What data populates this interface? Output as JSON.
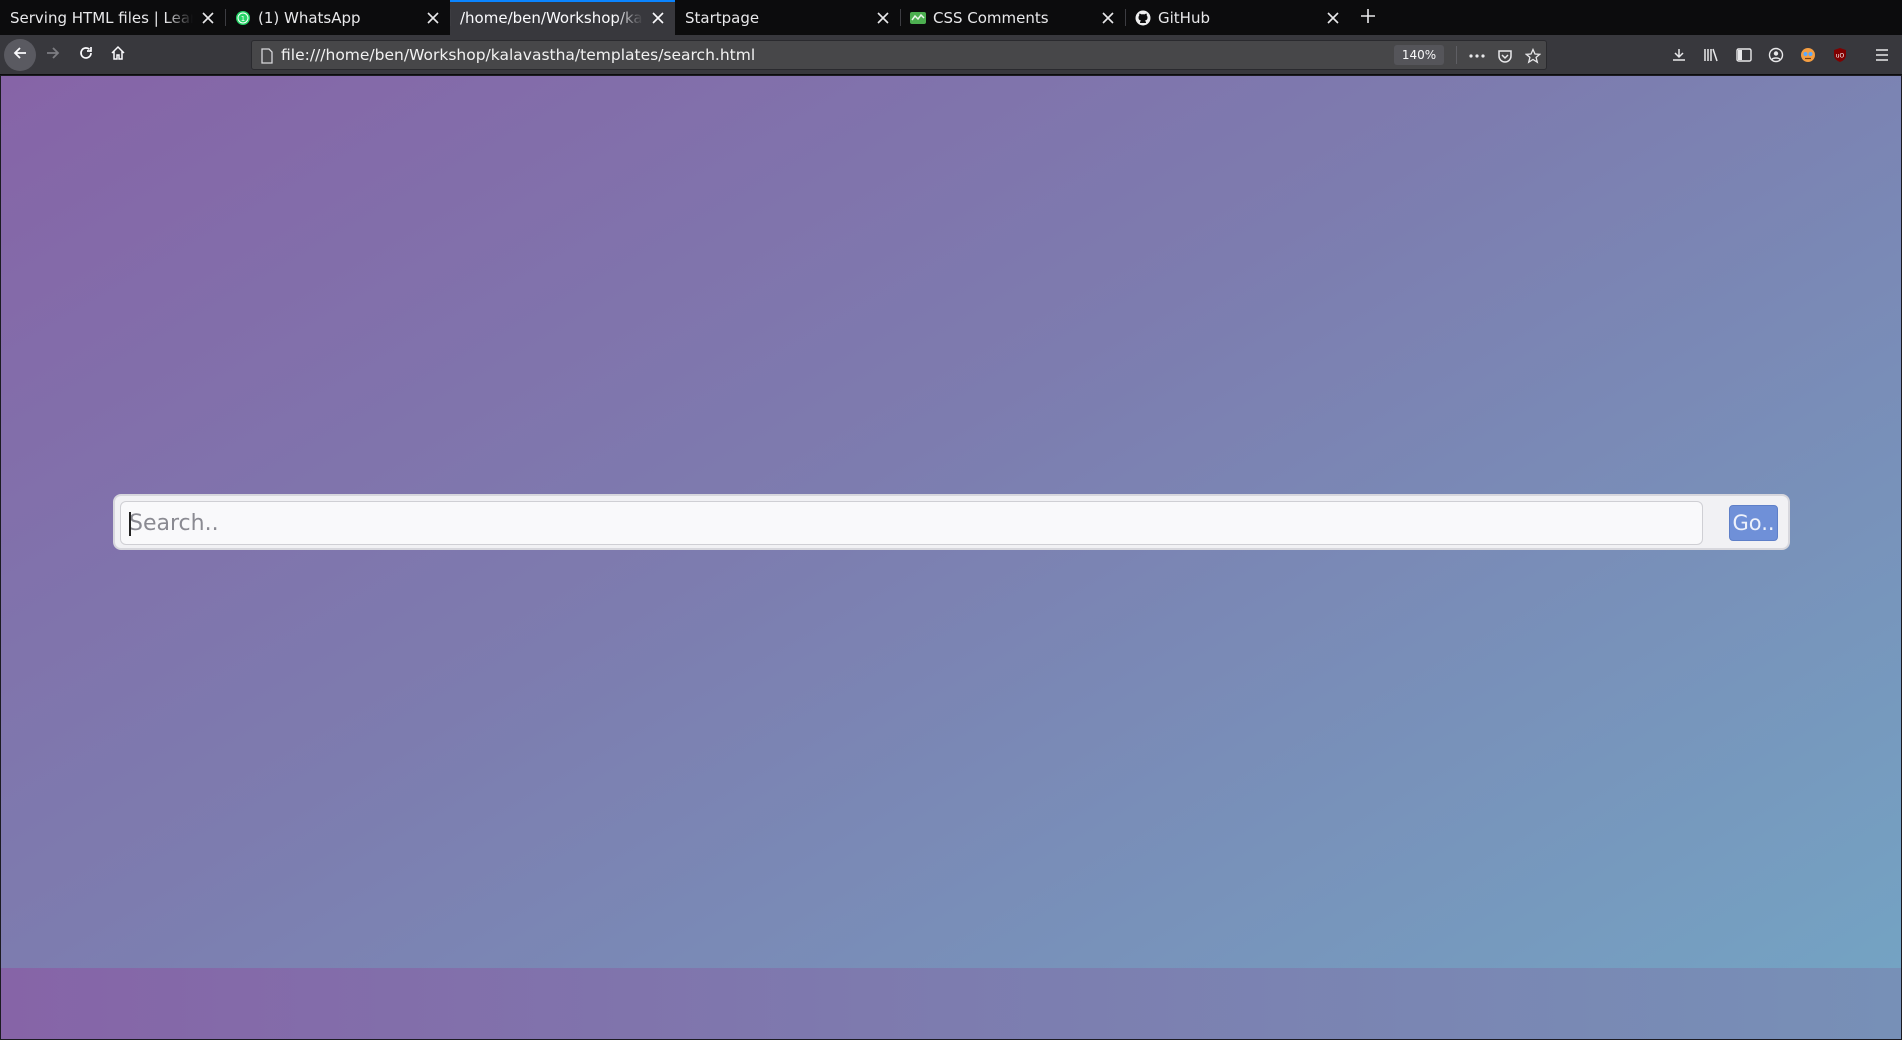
{
  "tabs": [
    {
      "title": "Serving HTML files | Learning",
      "favicon": "none",
      "active": false
    },
    {
      "title": "(1) WhatsApp",
      "favicon": "whatsapp-icon",
      "active": false
    },
    {
      "title": "/home/ben/Workshop/kalavastha",
      "favicon": "none",
      "active": true
    },
    {
      "title": "Startpage",
      "favicon": "none",
      "active": false
    },
    {
      "title": "CSS Comments",
      "favicon": "css-icon",
      "active": false
    },
    {
      "title": "GitHub",
      "favicon": "github-icon",
      "active": false
    }
  ],
  "navbar": {
    "url": "file:///home/ben/Workshop/kalavastha/templates/search.html",
    "zoom": "140%"
  },
  "page": {
    "search_placeholder": "Search..",
    "search_value": "",
    "go_label": "Go.."
  },
  "colors": {
    "gradient_start": "#8664a7",
    "gradient_end": "#74a3c3",
    "go_button": "#6f90d8",
    "active_tab_indicator": "#0a84ff"
  }
}
